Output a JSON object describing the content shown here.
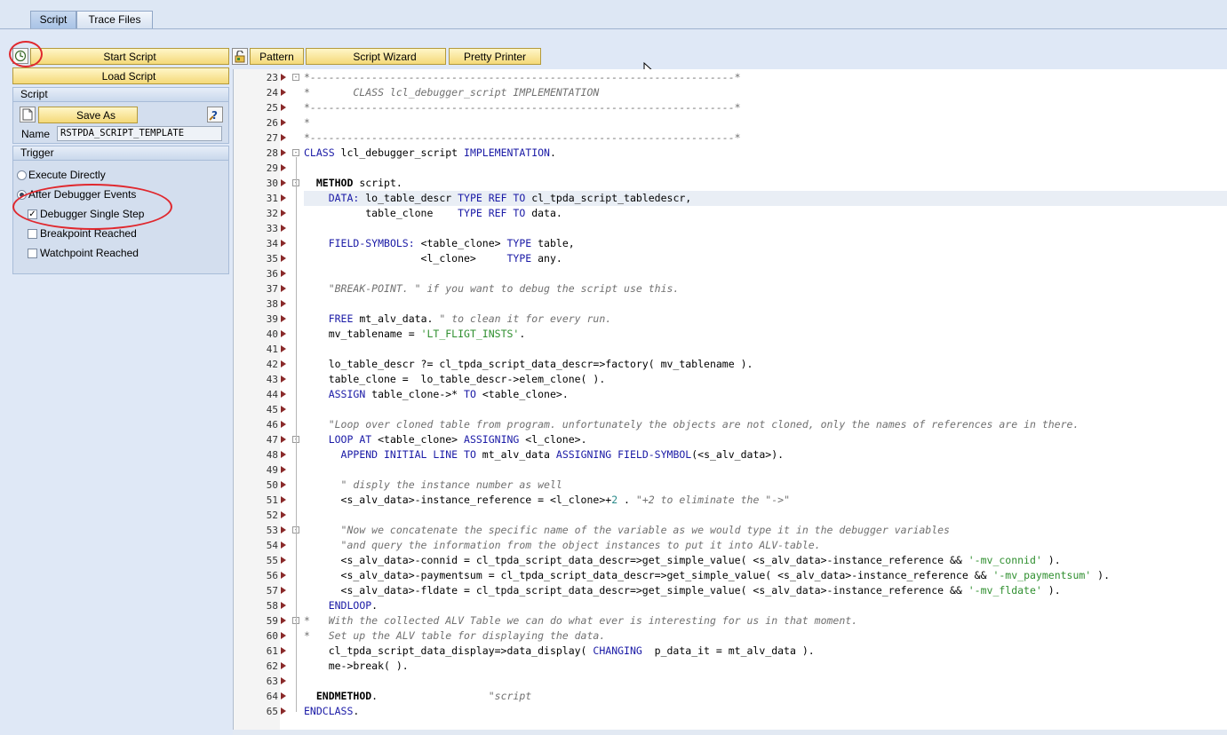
{
  "tabs": [
    {
      "label": "Script",
      "active": true
    },
    {
      "label": "Trace Files",
      "active": false
    }
  ],
  "toolbar": {
    "start_script": "Start Script",
    "load_script": "Load Script",
    "pattern": "Pattern",
    "script_wizard": "Script Wizard",
    "pretty_printer": "Pretty Printer"
  },
  "script_group": {
    "header": "Script",
    "save_as": "Save As",
    "name_label": "Name",
    "name_value": "RSTPDA_SCRIPT_TEMPLATE"
  },
  "trigger_group": {
    "header": "Trigger",
    "execute_directly": "Execute Directly",
    "after_debugger_events": "After Debugger Events",
    "debugger_single_step": "Debugger Single Step",
    "breakpoint_reached": "Breakpoint Reached",
    "watchpoint_reached": "Watchpoint Reached",
    "selected": "After Debugger Events",
    "checked": [
      "Debugger Single Step"
    ]
  },
  "colors": {
    "keyword": "#1a1aa6",
    "comment": "#707070",
    "string": "#2f8f2f",
    "number": "#2a8a8a",
    "annotation": "#e0282e",
    "button": "#f4d979"
  },
  "editor": {
    "lines": [
      {
        "n": "23",
        "fold": "-",
        "parts": [
          [
            "c",
            "*---------------------------------------------------------------------*"
          ]
        ]
      },
      {
        "n": "24",
        "parts": [
          [
            "c",
            "*       CLASS lcl_debugger_script IMPLEMENTATION"
          ]
        ]
      },
      {
        "n": "25",
        "parts": [
          [
            "c",
            "*---------------------------------------------------------------------*"
          ]
        ]
      },
      {
        "n": "26",
        "parts": [
          [
            "c",
            "*"
          ]
        ]
      },
      {
        "n": "27",
        "parts": [
          [
            "c",
            "*---------------------------------------------------------------------*"
          ]
        ]
      },
      {
        "n": "28",
        "fold": "-",
        "parts": [
          [
            "k",
            "CLASS"
          ],
          [
            "t",
            " lcl_debugger_script "
          ],
          [
            "k",
            "IMPLEMENTATION"
          ],
          [
            "t",
            "."
          ]
        ]
      },
      {
        "n": "29",
        "parts": []
      },
      {
        "n": "30",
        "fold": "-",
        "parts": [
          [
            "t",
            "  "
          ],
          [
            "b",
            "METHOD"
          ],
          [
            "t",
            " script."
          ]
        ]
      },
      {
        "n": "31",
        "hl": true,
        "parts": [
          [
            "t",
            "    "
          ],
          [
            "k",
            "DATA:"
          ],
          [
            "t",
            " lo_table_descr "
          ],
          [
            "k",
            "TYPE REF TO"
          ],
          [
            "t",
            " cl_tpda_script_tabledescr,"
          ]
        ]
      },
      {
        "n": "32",
        "parts": [
          [
            "t",
            "          table_clone    "
          ],
          [
            "k",
            "TYPE REF TO"
          ],
          [
            "t",
            " data."
          ]
        ]
      },
      {
        "n": "33",
        "parts": []
      },
      {
        "n": "34",
        "parts": [
          [
            "t",
            "    "
          ],
          [
            "k",
            "FIELD-SYMBOLS:"
          ],
          [
            "t",
            " <table_clone> "
          ],
          [
            "k",
            "TYPE"
          ],
          [
            "t",
            " table,"
          ]
        ]
      },
      {
        "n": "35",
        "parts": [
          [
            "t",
            "                   <l_clone>     "
          ],
          [
            "k",
            "TYPE"
          ],
          [
            "t",
            " any."
          ]
        ]
      },
      {
        "n": "36",
        "parts": []
      },
      {
        "n": "37",
        "parts": [
          [
            "t",
            "    "
          ],
          [
            "c",
            "\"BREAK-POINT. \" if you want to debug the script use this."
          ]
        ]
      },
      {
        "n": "38",
        "parts": []
      },
      {
        "n": "39",
        "parts": [
          [
            "t",
            "    "
          ],
          [
            "k",
            "FREE"
          ],
          [
            "t",
            " mt_alv_data. "
          ],
          [
            "c",
            "\" to clean it for every run."
          ]
        ]
      },
      {
        "n": "40",
        "parts": [
          [
            "t",
            "    mv_tablename = "
          ],
          [
            "s",
            "'LT_FLIGT_INSTS'"
          ],
          [
            "t",
            "."
          ]
        ]
      },
      {
        "n": "41",
        "parts": []
      },
      {
        "n": "42",
        "parts": [
          [
            "t",
            "    lo_table_descr ?= cl_tpda_script_data_descr=>factory( mv_tablename )."
          ]
        ]
      },
      {
        "n": "43",
        "parts": [
          [
            "t",
            "    table_clone =  lo_table_descr->elem_clone( )."
          ]
        ]
      },
      {
        "n": "44",
        "parts": [
          [
            "t",
            "    "
          ],
          [
            "k",
            "ASSIGN"
          ],
          [
            "t",
            " table_clone->* "
          ],
          [
            "k",
            "TO"
          ],
          [
            "t",
            " <table_clone>."
          ]
        ]
      },
      {
        "n": "45",
        "parts": []
      },
      {
        "n": "46",
        "parts": [
          [
            "t",
            "    "
          ],
          [
            "c",
            "\"Loop over cloned table from program. unfortunately the objects are not cloned, only the names of references are in there."
          ]
        ]
      },
      {
        "n": "47",
        "fold": "-",
        "parts": [
          [
            "t",
            "    "
          ],
          [
            "k",
            "LOOP AT"
          ],
          [
            "t",
            " <table_clone> "
          ],
          [
            "k",
            "ASSIGNING"
          ],
          [
            "t",
            " <l_clone>."
          ]
        ]
      },
      {
        "n": "48",
        "parts": [
          [
            "t",
            "      "
          ],
          [
            "k",
            "APPEND INITIAL LINE TO"
          ],
          [
            "t",
            " mt_alv_data "
          ],
          [
            "k",
            "ASSIGNING FIELD-SYMBOL"
          ],
          [
            "t",
            "(<s_alv_data>)."
          ]
        ]
      },
      {
        "n": "49",
        "parts": []
      },
      {
        "n": "50",
        "parts": [
          [
            "t",
            "      "
          ],
          [
            "c",
            "\" disply the instance number as well"
          ]
        ]
      },
      {
        "n": "51",
        "parts": [
          [
            "t",
            "      <s_alv_data>-instance_reference = <l_clone>+"
          ],
          [
            "n",
            "2"
          ],
          [
            "t",
            " . "
          ],
          [
            "c",
            "\"+2 to eliminate the \"->\""
          ]
        ]
      },
      {
        "n": "52",
        "parts": []
      },
      {
        "n": "53",
        "fold": "-",
        "parts": [
          [
            "t",
            "      "
          ],
          [
            "c",
            "\"Now we concatenate the specific name of the variable as we would type it in the debugger variables"
          ]
        ]
      },
      {
        "n": "54",
        "parts": [
          [
            "t",
            "      "
          ],
          [
            "c",
            "\"and query the information from the object instances to put it into ALV-table."
          ]
        ]
      },
      {
        "n": "55",
        "parts": [
          [
            "t",
            "      <s_alv_data>-connid = cl_tpda_script_data_descr=>get_simple_value( <s_alv_data>-instance_reference && "
          ],
          [
            "s",
            "'-mv_connid'"
          ],
          [
            "t",
            " )."
          ]
        ]
      },
      {
        "n": "56",
        "parts": [
          [
            "t",
            "      <s_alv_data>-paymentsum = cl_tpda_script_data_descr=>get_simple_value( <s_alv_data>-instance_reference && "
          ],
          [
            "s",
            "'-mv_paymentsum'"
          ],
          [
            "t",
            " )."
          ]
        ]
      },
      {
        "n": "57",
        "parts": [
          [
            "t",
            "      <s_alv_data>-fldate = cl_tpda_script_data_descr=>get_simple_value( <s_alv_data>-instance_reference && "
          ],
          [
            "s",
            "'-mv_fldate'"
          ],
          [
            "t",
            " )."
          ]
        ]
      },
      {
        "n": "58",
        "parts": [
          [
            "t",
            "    "
          ],
          [
            "k",
            "ENDLOOP"
          ],
          [
            "t",
            "."
          ]
        ]
      },
      {
        "n": "59",
        "fold": "-",
        "parts": [
          [
            "c",
            "*   With the collected ALV Table we can do what ever is interesting for us in that moment."
          ]
        ]
      },
      {
        "n": "60",
        "parts": [
          [
            "c",
            "*   Set up the ALV table for displaying the data."
          ]
        ]
      },
      {
        "n": "61",
        "parts": [
          [
            "t",
            "    cl_tpda_script_data_display=>data_display( "
          ],
          [
            "k",
            "CHANGING"
          ],
          [
            "t",
            "  p_data_it = mt_alv_data )."
          ]
        ]
      },
      {
        "n": "62",
        "parts": [
          [
            "t",
            "    me->break( )."
          ]
        ]
      },
      {
        "n": "63",
        "parts": []
      },
      {
        "n": "64",
        "parts": [
          [
            "t",
            "  "
          ],
          [
            "b",
            "ENDMETHOD"
          ],
          [
            "t",
            ".                  "
          ],
          [
            "c",
            "\"script"
          ]
        ]
      },
      {
        "n": "65",
        "parts": [
          [
            "k",
            "ENDCLASS"
          ],
          [
            "t",
            "."
          ]
        ]
      }
    ]
  }
}
